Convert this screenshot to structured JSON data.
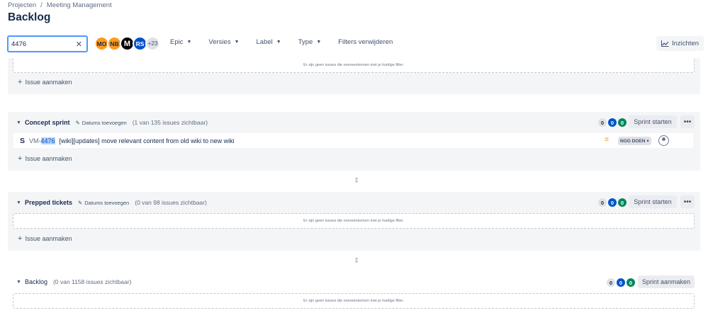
{
  "breadcrumb": {
    "root": "Projecten",
    "sep": "/",
    "current": "Meeting Management"
  },
  "page_title": "Backlog",
  "search": {
    "value": "4476"
  },
  "avatars": [
    {
      "initials": "MO"
    },
    {
      "initials": "NB"
    },
    {
      "initials": "M"
    },
    {
      "initials": "RS"
    },
    {
      "initials": "+23"
    }
  ],
  "filters": {
    "epic": "Epic",
    "versions": "Versies",
    "label": "Label",
    "type": "Type",
    "clear": "Filters verwijderen"
  },
  "insights_label": "Inzichten",
  "empty_text": "Er zijn geen issues die overeenkomen met je huidige filter.",
  "create_issue": "Issue aanmaken",
  "sprints": {
    "concept": {
      "name": "Concept sprint",
      "dates": "Datums toevoegen",
      "count": "(1 van 135 issues zichtbaar)",
      "badges": [
        "0",
        "0",
        "0"
      ],
      "action": "Sprint starten"
    },
    "prepped": {
      "name": "Prepped tickets",
      "dates": "Datums toevoegen",
      "count": "(0 van 98 issues zichtbaar)",
      "badges": [
        "0",
        "0",
        "0"
      ],
      "action": "Sprint starten"
    },
    "backlog": {
      "name": "Backlog",
      "count": "(0 van 1158 issues zichtbaar)",
      "badges": [
        "0",
        "0",
        "0"
      ],
      "action": "Sprint aanmaken"
    }
  },
  "issue": {
    "type": "S",
    "key_prefix": "VM-",
    "key_match": "4476",
    "summary": "[wiki][updates] move relevant content from old wiki to new wiki",
    "priority": "=",
    "status": "NOG DOEN"
  },
  "colors": {
    "accent": "#0052cc",
    "priority_medium": "#ff991f",
    "done": "#00875a"
  }
}
